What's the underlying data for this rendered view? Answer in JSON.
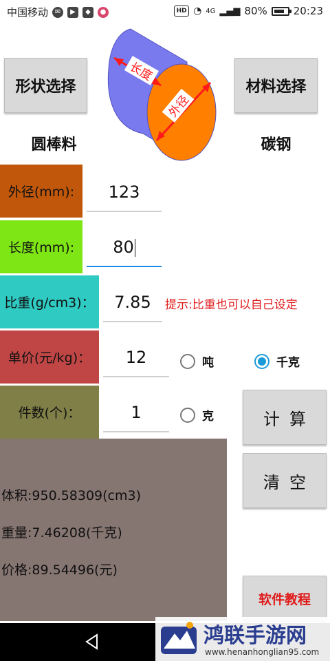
{
  "status_bar": {
    "carrier": "中国移动",
    "network": "4G",
    "battery": "80%",
    "time": "20:23",
    "hd": "HD"
  },
  "toolbar": {
    "shape_button": "形状选择",
    "material_button": "材料选择",
    "shape_value": "圆棒料",
    "material_value": "碳钢"
  },
  "diagram": {
    "length_label": "长度",
    "diameter_label": "外径",
    "side_color": "#7a7aef",
    "face_color": "#ff7f00",
    "arrow_color": "#ff1a1a"
  },
  "rows": [
    {
      "label": "外径(mm):",
      "value": "123",
      "color": "#c0570a"
    },
    {
      "label": "长度(mm):",
      "value": "80",
      "color": "#7ee615"
    },
    {
      "label": "比重(g/cm3)：",
      "value": "7.85",
      "color": "#2fcac2"
    },
    {
      "label": "单价(元/kg)：",
      "value": "12",
      "color": "#c04646"
    },
    {
      "label": "件数(个)：",
      "value": "1",
      "color": "#7f7f47"
    }
  ],
  "hint": "提示:比重也可以自己设定",
  "units": {
    "ton": "吨",
    "kg": "千克",
    "gram": "克",
    "selected": "千克"
  },
  "buttons": {
    "calculate": "计算",
    "clear": "清空",
    "tutorial": "软件教程"
  },
  "result": {
    "background": "#867672",
    "volume": "体积:950.58309(cm3)",
    "weight": "重量:7.46208(千克)",
    "price": "价格:89.54496(元)"
  },
  "watermark": {
    "title": "鸿联手游网",
    "url": "www.henanhonglian95.com"
  }
}
